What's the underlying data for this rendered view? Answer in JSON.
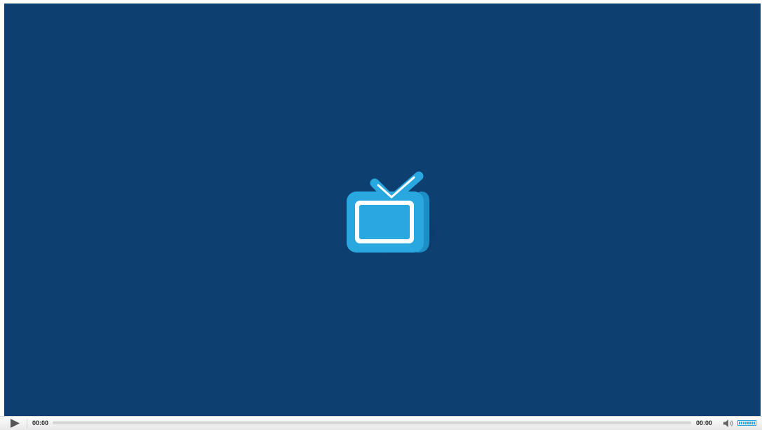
{
  "player": {
    "background_color": "#0e3f71",
    "logo_icon": "tv-icon",
    "accent_color": "#29a8e0",
    "controls": {
      "play_icon": "play-icon",
      "current_time": "00:00",
      "total_time": "00:00",
      "progress": 0,
      "volume_icon": "volume-icon",
      "volume_level": 1.0
    }
  }
}
